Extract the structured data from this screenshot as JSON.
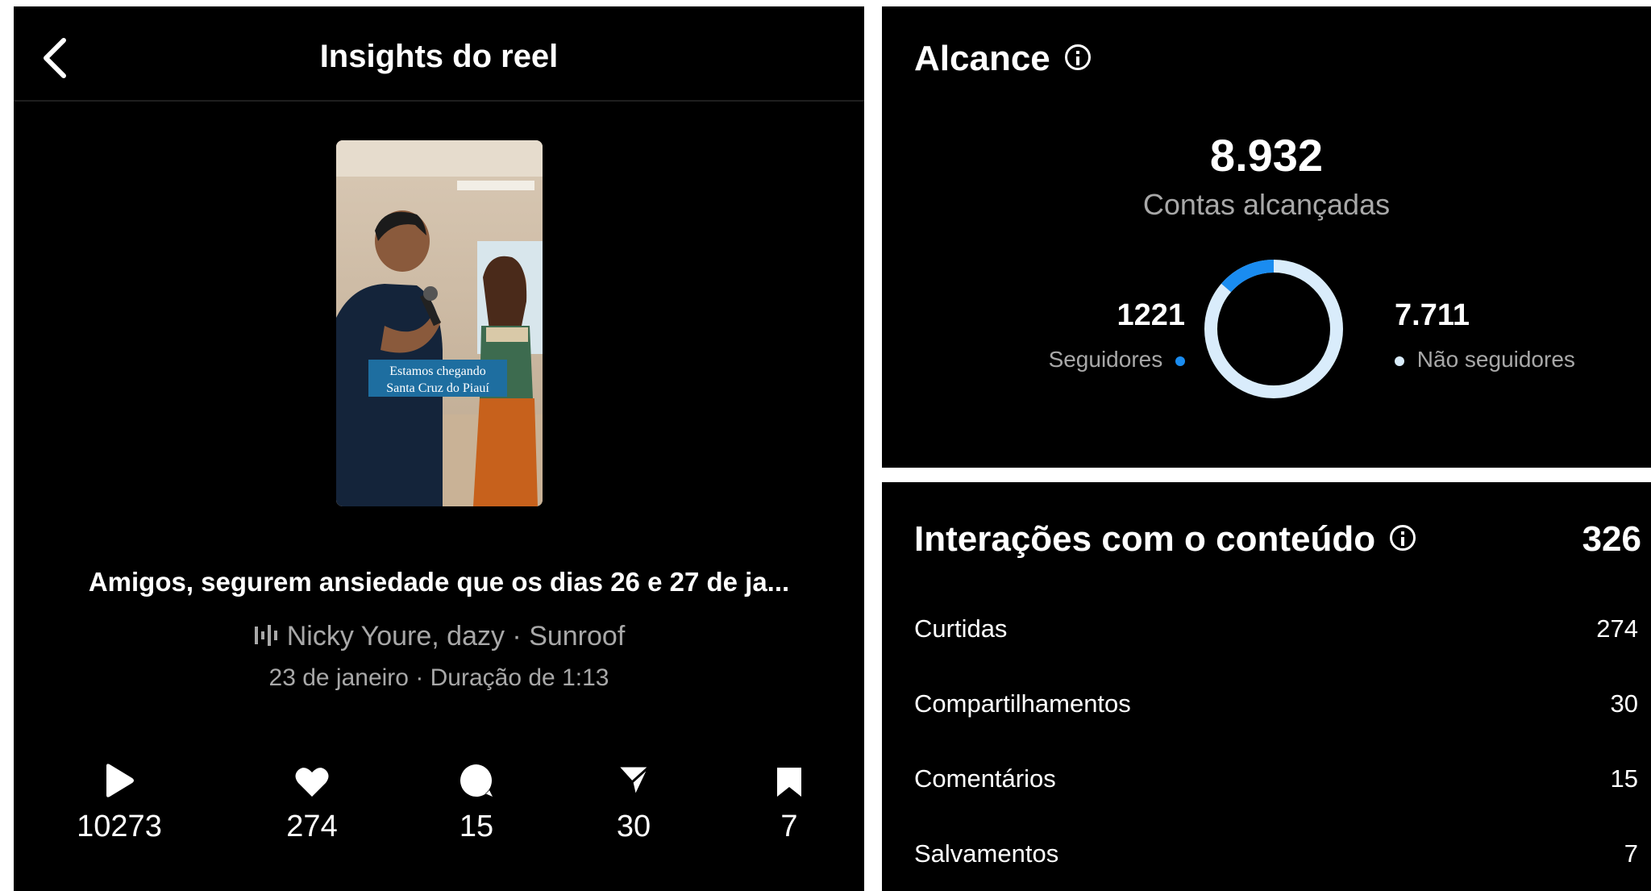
{
  "reel": {
    "header_title": "Insights do reel",
    "video_overlay_text": [
      "Estamos chegando",
      "Santa Cruz do Piauí"
    ],
    "caption": "Amigos, segurem ansiedade que os dias 26 e 27 de ja...",
    "audio": "Nicky Youre, dazy · Sunroof",
    "date_duration": "23 de janeiro · Duração de 1:13",
    "stats": {
      "plays": "10273",
      "likes": "274",
      "comments": "15",
      "shares": "30",
      "saves": "7"
    }
  },
  "reach": {
    "title": "Alcance",
    "total": "8.932",
    "total_label": "Contas alcançadas",
    "followers_value": "1221",
    "followers_label": "Seguidores",
    "non_followers_value": "7.711",
    "non_followers_label": "Não seguidores",
    "followers_fraction": 0.137,
    "colors": {
      "followers": "#1a8cf0",
      "non_followers": "#d9ecfb"
    }
  },
  "interactions": {
    "title": "Interações com o conteúdo",
    "total": "326",
    "rows": [
      {
        "label": "Curtidas",
        "value": "274"
      },
      {
        "label": "Compartilhamentos",
        "value": "30"
      },
      {
        "label": "Comentários",
        "value": "15"
      },
      {
        "label": "Salvamentos",
        "value": "7"
      }
    ]
  },
  "icons": [
    "back-arrow-icon",
    "audio-wave-icon",
    "play-icon",
    "heart-icon",
    "comment-icon",
    "send-icon",
    "bookmark-icon",
    "info-icon"
  ]
}
